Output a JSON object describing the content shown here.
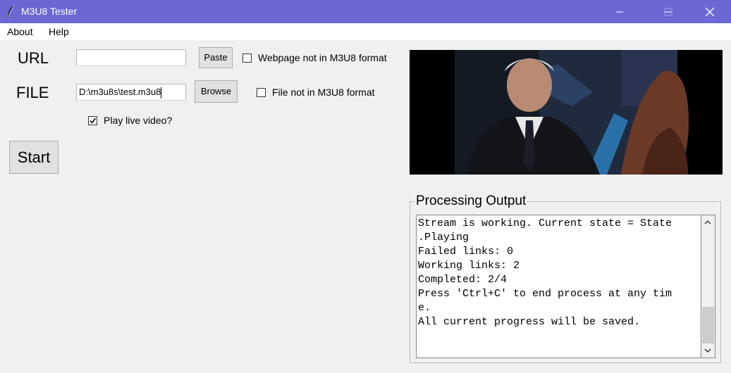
{
  "window": {
    "title": "M3U8 Tester",
    "icon": "feather-icon",
    "title_bar_color": "#6b68d4"
  },
  "menu": {
    "items": [
      "About",
      "Help"
    ]
  },
  "form": {
    "url_label": "URL",
    "url_value": "",
    "paste_label": "Paste",
    "webpage_checkbox_label": "Webpage not in M3U8 format",
    "webpage_checked": false,
    "file_label": "FILE",
    "file_value": "D:\\m3u8s\\test.m3u8",
    "browse_label": "Browse",
    "file_checkbox_label": "File not in M3U8 format",
    "file_checked": false,
    "play_live_label": "Play live video?",
    "play_live_checked": true,
    "start_label": "Start"
  },
  "output": {
    "legend": "Processing Output",
    "lines": [
      "Stream is working. Current state = State",
      ".Playing",
      "Failed links: 0",
      "Working links: 2",
      "Completed: 2/4",
      "Press 'Ctrl+C' to end process at any tim",
      "e.",
      "All current progress will be saved."
    ]
  }
}
